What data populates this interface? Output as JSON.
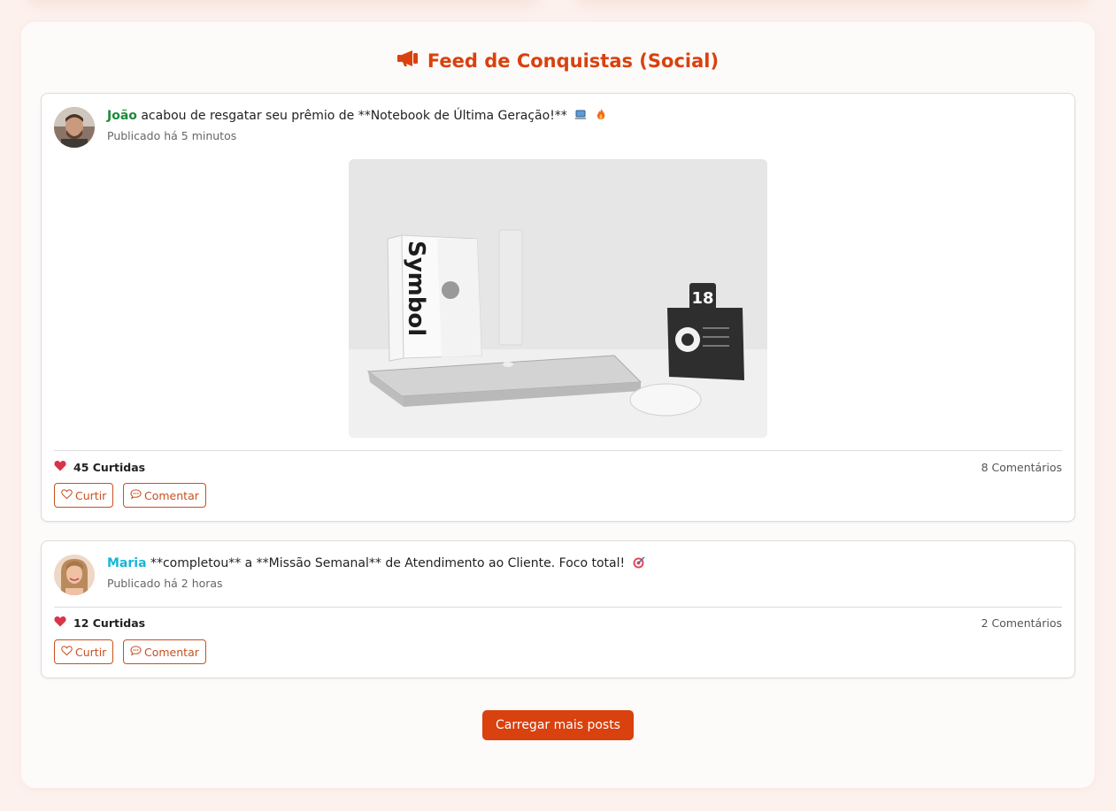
{
  "feed": {
    "title": "Feed de Conquistas (Social)",
    "load_more_label": "Carregar mais posts"
  },
  "posts": [
    {
      "author": "João",
      "message": " acabou de resgatar seu prêmio de **Notebook de Última Geração!**",
      "emojis": [
        "laptop-emoji",
        "fire-emoji"
      ],
      "time": "Publicado há 5 minutos",
      "likes": "45 Curtidas",
      "comments": "8 Comentários",
      "like_button": "Curtir",
      "comment_button": "Comentar",
      "image_text": {
        "book_title": "Symbol",
        "calendar_day": "18"
      }
    },
    {
      "author": "Maria",
      "message": " **completou** a **Missão Semanal** de Atendimento ao Cliente. Foco total!",
      "emojis": [
        "target-emoji"
      ],
      "time": "Publicado há 2 horas",
      "likes": "12 Curtidas",
      "comments": "2 Comentários",
      "like_button": "Curtir",
      "comment_button": "Comentar"
    }
  ],
  "colors": {
    "accent": "#d9410e",
    "author_1": "#1b8a3a",
    "author_2": "#17b6d8",
    "heart": "#d8344a"
  }
}
